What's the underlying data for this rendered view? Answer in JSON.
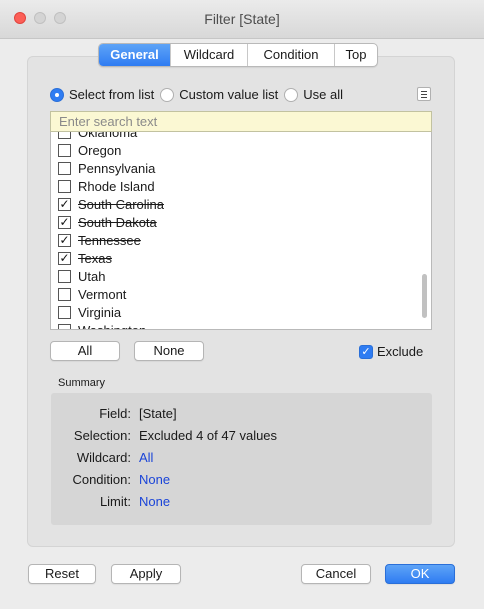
{
  "window": {
    "title": "Filter [State]"
  },
  "tabs": [
    {
      "label": "General",
      "active": true
    },
    {
      "label": "Wildcard",
      "active": false
    },
    {
      "label": "Condition",
      "active": false
    },
    {
      "label": "Top",
      "active": false
    }
  ],
  "radios": [
    {
      "label": "Select from list",
      "selected": true
    },
    {
      "label": "Custom value list",
      "selected": false
    },
    {
      "label": "Use all",
      "selected": false
    }
  ],
  "search": {
    "placeholder": "Enter search text"
  },
  "list": {
    "items": [
      {
        "name": "Oklahoma",
        "checked": false
      },
      {
        "name": "Oregon",
        "checked": false
      },
      {
        "name": "Pennsylvania",
        "checked": false
      },
      {
        "name": "Rhode Island",
        "checked": false
      },
      {
        "name": "South Carolina",
        "checked": true
      },
      {
        "name": "South Dakota",
        "checked": true
      },
      {
        "name": "Tennessee",
        "checked": true
      },
      {
        "name": "Texas",
        "checked": true
      },
      {
        "name": "Utah",
        "checked": false
      },
      {
        "name": "Vermont",
        "checked": false
      },
      {
        "name": "Virginia",
        "checked": false
      },
      {
        "name": "Washington",
        "checked": false
      }
    ]
  },
  "actions": {
    "all_label": "All",
    "none_label": "None",
    "exclude_label": "Exclude",
    "exclude_checked": true
  },
  "summary": {
    "heading": "Summary",
    "rows": [
      {
        "label": "Field:",
        "value": "[State]",
        "link": false
      },
      {
        "label": "Selection:",
        "value": "Excluded 4 of 47 values",
        "link": false
      },
      {
        "label": "Wildcard:",
        "value": "All",
        "link": true
      },
      {
        "label": "Condition:",
        "value": "None",
        "link": true
      },
      {
        "label": "Limit:",
        "value": "None",
        "link": true
      }
    ]
  },
  "footer": {
    "reset_label": "Reset",
    "apply_label": "Apply",
    "cancel_label": "Cancel",
    "ok_label": "OK"
  },
  "colors": {
    "accent": "#2f7cf2",
    "link": "#1a44d8",
    "search_bg": "#fbf8d3"
  }
}
